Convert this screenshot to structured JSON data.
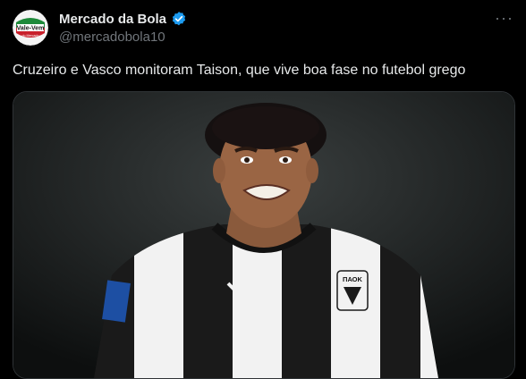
{
  "account": {
    "display_name": "Mercado da Bola",
    "handle": "@mercadobola10",
    "avatar_text": "Vale-Vem",
    "avatar_subtext": "do Mercado",
    "verified_color": "#1d9bf0"
  },
  "tweet": {
    "text": "Cruzeiro e Vasco monitoram Taison, que vive boa fase no futebol grego"
  },
  "media": {
    "crest_text": "ΠΑΟΚ",
    "colors": {
      "stripe_dark": "#1a1a1a",
      "stripe_light": "#f2f2f2"
    }
  },
  "icons": [
    "verified-icon",
    "more-icon"
  ]
}
